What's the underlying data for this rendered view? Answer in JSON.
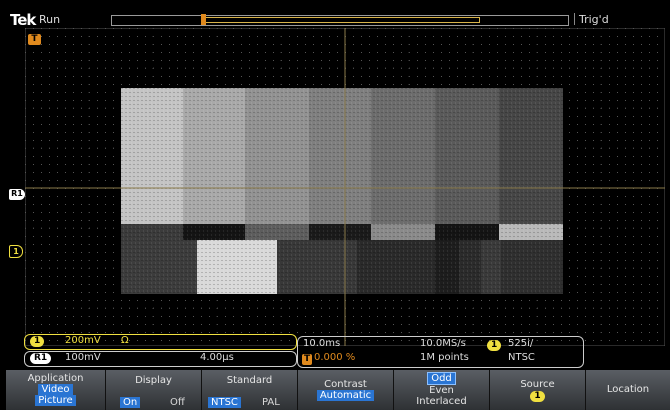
{
  "top": {
    "logo": "Tek",
    "run_state": "Run",
    "trigger_state": "Trig'd"
  },
  "markers": {
    "trigger_pos": "T",
    "ref1": "R1",
    "ch1": "1"
  },
  "readouts": {
    "ch1": {
      "badge": "1",
      "scale": "200mV",
      "coupling": "Ω"
    },
    "ref": {
      "badge": "R1",
      "scale": "100mV",
      "time": "4.00μs"
    },
    "timebase": {
      "horizontal": "10.0ms",
      "sample_rate": "10.0MS/s",
      "trig_pos_icon": "T",
      "trig_pos": "0.000 %",
      "record": "1M points"
    },
    "video_trig": {
      "badge": "1",
      "lines": "525i/",
      "standard": "NTSC"
    }
  },
  "menu": {
    "application": {
      "label": "Application",
      "line2": "Video",
      "line3": "Picture"
    },
    "display": {
      "label": "Display",
      "on": "On",
      "off": "Off"
    },
    "standard": {
      "label": "Standard",
      "ntsc": "NTSC",
      "pal": "PAL"
    },
    "contrast": {
      "label": "Contrast",
      "value": "Automatic"
    },
    "field": {
      "odd": "Odd",
      "even": "Even",
      "interlaced": "Interlaced"
    },
    "source": {
      "label": "Source",
      "value": "1"
    },
    "location": {
      "label": "Location"
    }
  },
  "colors": {
    "ch1_yellow": "#f0e040",
    "trigger_orange": "#e08a1e",
    "ref_white": "#ffffff",
    "menu_highlight": "#2a75d3"
  }
}
